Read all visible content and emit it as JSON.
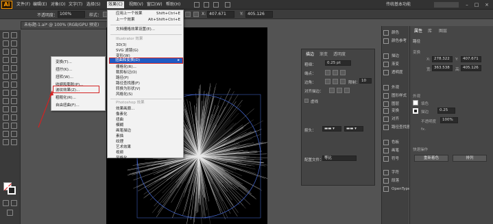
{
  "menubar": {
    "logo": "Ai",
    "items": [
      "文件(F)",
      "编辑(E)",
      "对象(O)",
      "文字(T)",
      "选择(S)",
      "效果(C)",
      "视图(V)",
      "窗口(W)",
      "帮助(H)"
    ],
    "workspace": "传统基本功能"
  },
  "controlbar": {
    "opacity_label": "不透明度：",
    "opacity_value": "100%",
    "style_label": "样式：",
    "x_value": "407.671",
    "y_value": "405.126"
  },
  "document_tab": {
    "title": "未标题-1.ai* @ 100% (RGB/GPU 预览)"
  },
  "context_menu": {
    "items": [
      "变换(T)...",
      "扭拧(K)...",
      "扭转(W)...",
      "收缩和膨胀(P)...",
      "波纹效果(Z)...",
      "粗糙化(R)...",
      "自由扭曲(F)..."
    ],
    "highlighted": "波纹效果(Z)..."
  },
  "effect_menu": {
    "apply_last": "应用上一个效果",
    "apply_last_shortcut": "Shift+Ctrl+E",
    "last_effect": "上一个效果",
    "last_effect_shortcut": "Alt+Shift+Ctrl+E",
    "doc_raster": "文档栅格效果设置(E)...",
    "illustrator_section": "Illustrator 效果",
    "illustrator_items": [
      "3D(3)",
      "SVG 滤镜(G)",
      "变形(W)",
      "扭曲和变换(D)",
      "栅格化(R)...",
      "裁剪标记(O)",
      "路径(P)",
      "路径查找器(F)",
      "转换为形状(V)",
      "风格化(S)"
    ],
    "highlighted": "扭曲和变换(D)",
    "photoshop_section": "Photoshop 效果",
    "photoshop_items": [
      "效果画廊...",
      "像素化",
      "扭曲",
      "模糊",
      "画笔描边",
      "素描",
      "纹理",
      "艺术效果",
      "视频",
      "风格化"
    ]
  },
  "stroke_panel": {
    "tabs": [
      "描边",
      "渐变",
      "透明度"
    ],
    "weight_label": "粗细：",
    "weight_value": "0.25 pt",
    "cap_label": "端点：",
    "corner_label": "边角：",
    "limit_label": "限制：",
    "limit_value": "10",
    "align_label": "对齐描边：",
    "dashed_label": "虚线",
    "arrow_label": "箭头：",
    "profile_label": "配置文件：",
    "profile_value": "等比"
  },
  "icon_column": {
    "items": [
      "颜色",
      "颜色参考",
      "描边",
      "渐变",
      "透明度",
      "外观",
      "图形样式",
      "图层",
      "变换",
      "对齐",
      "路径查找器",
      "色板",
      "画笔",
      "符号",
      "字符",
      "段落",
      "OpenType"
    ]
  },
  "properties_panel": {
    "tabs": [
      "属性",
      "库",
      "图层"
    ],
    "path_label": "路径",
    "transform_label": "变换",
    "x": "278.322",
    "y": "407.671",
    "w": "363.538",
    "h": "405.126",
    "appearance_label": "外观",
    "fill_label": "填色",
    "stroke_label": "描边",
    "stroke_value": "0.25",
    "opacity_label": "不透明度",
    "opacity_value": "100%",
    "fx_label": "fx.",
    "quick_actions": "快速操作",
    "recolor_btn": "重新着色",
    "arrange_btn": "排列"
  }
}
